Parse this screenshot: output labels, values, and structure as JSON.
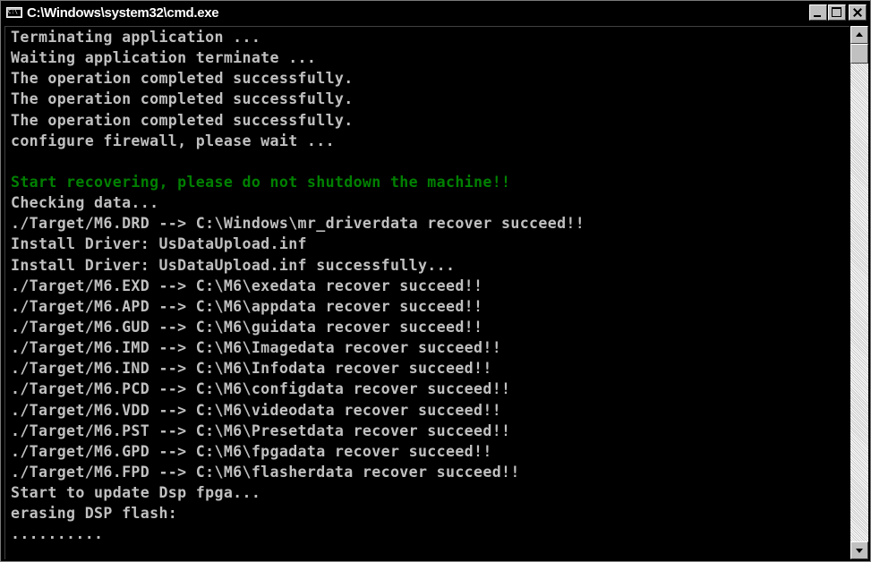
{
  "window": {
    "title": "C:\\Windows\\system32\\cmd.exe",
    "icon": "cmd-console-icon",
    "buttons": [
      "minimize-icon",
      "maximize-icon",
      "close-icon"
    ]
  },
  "colors": {
    "background": "#000000",
    "text": "#c0c0c0",
    "highlight": "#008000"
  },
  "console": {
    "lines": [
      {
        "text": "Terminating application ...",
        "color": "default"
      },
      {
        "text": "Waiting application terminate ...",
        "color": "default"
      },
      {
        "text": "The operation completed successfully.",
        "color": "default"
      },
      {
        "text": "The operation completed successfully.",
        "color": "default"
      },
      {
        "text": "The operation completed successfully.",
        "color": "default"
      },
      {
        "text": "configure firewall, please wait ...",
        "color": "default"
      },
      {
        "text": "",
        "color": "default"
      },
      {
        "text": "Start recovering, please do not shutdown the machine!!",
        "color": "green"
      },
      {
        "text": "Checking data...",
        "color": "default"
      },
      {
        "text": "./Target/M6.DRD --> C:\\Windows\\mr_driverdata recover succeed!!",
        "color": "default"
      },
      {
        "text": "Install Driver: UsDataUpload.inf",
        "color": "default"
      },
      {
        "text": "Install Driver: UsDataUpload.inf successfully...",
        "color": "default"
      },
      {
        "text": "./Target/M6.EXD --> C:\\M6\\exedata recover succeed!!",
        "color": "default"
      },
      {
        "text": "./Target/M6.APD --> C:\\M6\\appdata recover succeed!!",
        "color": "default"
      },
      {
        "text": "./Target/M6.GUD --> C:\\M6\\guidata recover succeed!!",
        "color": "default"
      },
      {
        "text": "./Target/M6.IMD --> C:\\M6\\Imagedata recover succeed!!",
        "color": "default"
      },
      {
        "text": "./Target/M6.IND --> C:\\M6\\Infodata recover succeed!!",
        "color": "default"
      },
      {
        "text": "./Target/M6.PCD --> C:\\M6\\configdata recover succeed!!",
        "color": "default"
      },
      {
        "text": "./Target/M6.VDD --> C:\\M6\\videodata recover succeed!!",
        "color": "default"
      },
      {
        "text": "./Target/M6.PST --> C:\\M6\\Presetdata recover succeed!!",
        "color": "default"
      },
      {
        "text": "./Target/M6.GPD --> C:\\M6\\fpgadata recover succeed!!",
        "color": "default"
      },
      {
        "text": "./Target/M6.FPD --> C:\\M6\\flasherdata recover succeed!!",
        "color": "default"
      },
      {
        "text": "Start to update Dsp fpga...",
        "color": "default"
      },
      {
        "text": "erasing DSP flash:",
        "color": "default"
      },
      {
        "text": "..........",
        "color": "default"
      }
    ]
  }
}
